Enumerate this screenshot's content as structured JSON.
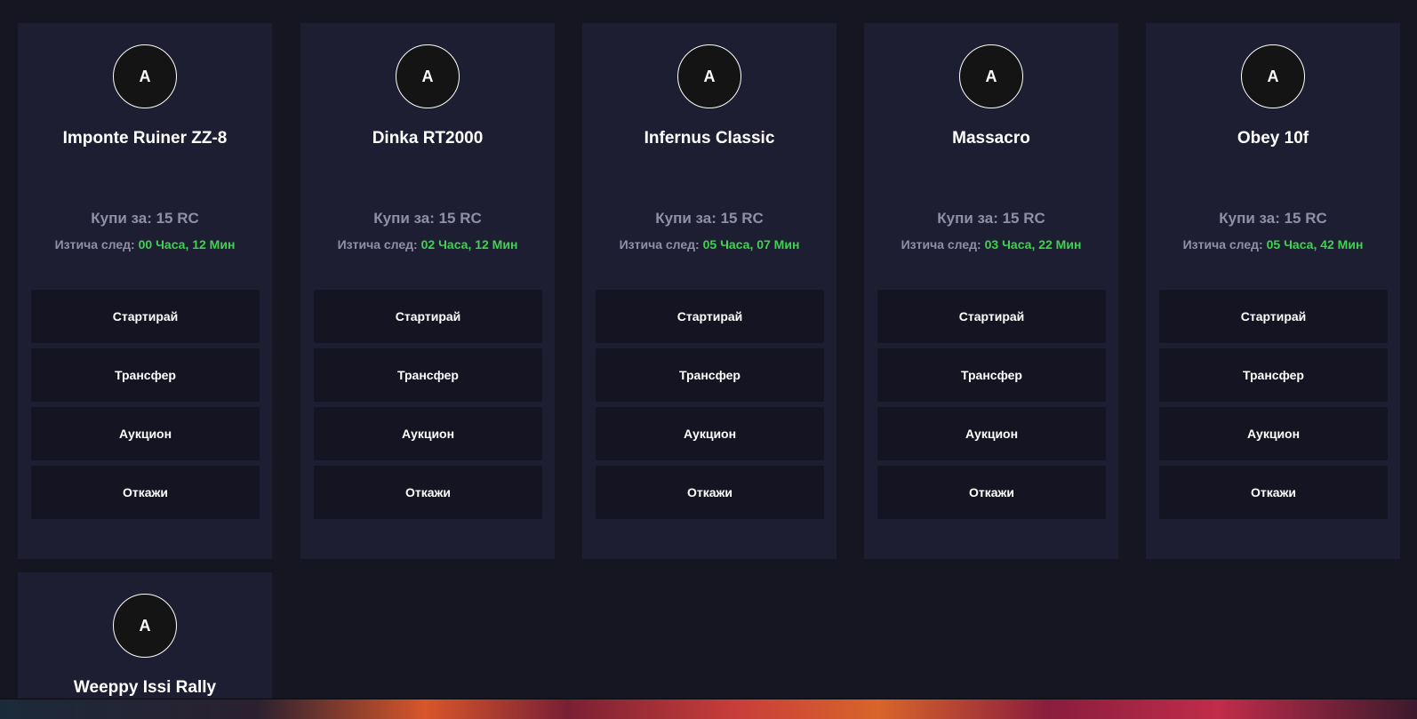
{
  "cards": [
    {
      "avatar_letter": "A",
      "name": "Imponte Ruiner ZZ-8",
      "price": "Купи за: 15 RC",
      "expiry_label": "Изтича след: ",
      "expiry_time": "00 Часа, 12 Мин",
      "buttons": {
        "start": "Стартирай",
        "transfer": "Трансфер",
        "auction": "Аукцион",
        "decline": "Откажи"
      }
    },
    {
      "avatar_letter": "A",
      "name": "Dinka RT2000",
      "price": "Купи за: 15 RC",
      "expiry_label": "Изтича след: ",
      "expiry_time": "02 Часа, 12 Мин",
      "buttons": {
        "start": "Стартирай",
        "transfer": "Трансфер",
        "auction": "Аукцион",
        "decline": "Откажи"
      }
    },
    {
      "avatar_letter": "A",
      "name": "Infernus Classic",
      "price": "Купи за: 15 RC",
      "expiry_label": "Изтича след: ",
      "expiry_time": "05 Часа, 07 Мин",
      "buttons": {
        "start": "Стартирай",
        "transfer": "Трансфер",
        "auction": "Аукцион",
        "decline": "Откажи"
      }
    },
    {
      "avatar_letter": "A",
      "name": "Massacro",
      "price": "Купи за: 15 RC",
      "expiry_label": "Изтича след: ",
      "expiry_time": "03 Часа, 22 Мин",
      "buttons": {
        "start": "Стартирай",
        "transfer": "Трансфер",
        "auction": "Аукцион",
        "decline": "Откажи"
      }
    },
    {
      "avatar_letter": "A",
      "name": "Obey 10f",
      "price": "Купи за: 15 RC",
      "expiry_label": "Изтича след: ",
      "expiry_time": "05 Часа, 42 Мин",
      "buttons": {
        "start": "Стартирай",
        "transfer": "Трансфер",
        "auction": "Аукцион",
        "decline": "Откажи"
      }
    },
    {
      "avatar_letter": "A",
      "name": "Weeppy Issi Rally"
    }
  ],
  "colors": {
    "background": "#161622",
    "card": "#1e1e32",
    "button": "#141422",
    "accent_green": "#3fd14f",
    "muted_text": "#8f8fa6"
  }
}
